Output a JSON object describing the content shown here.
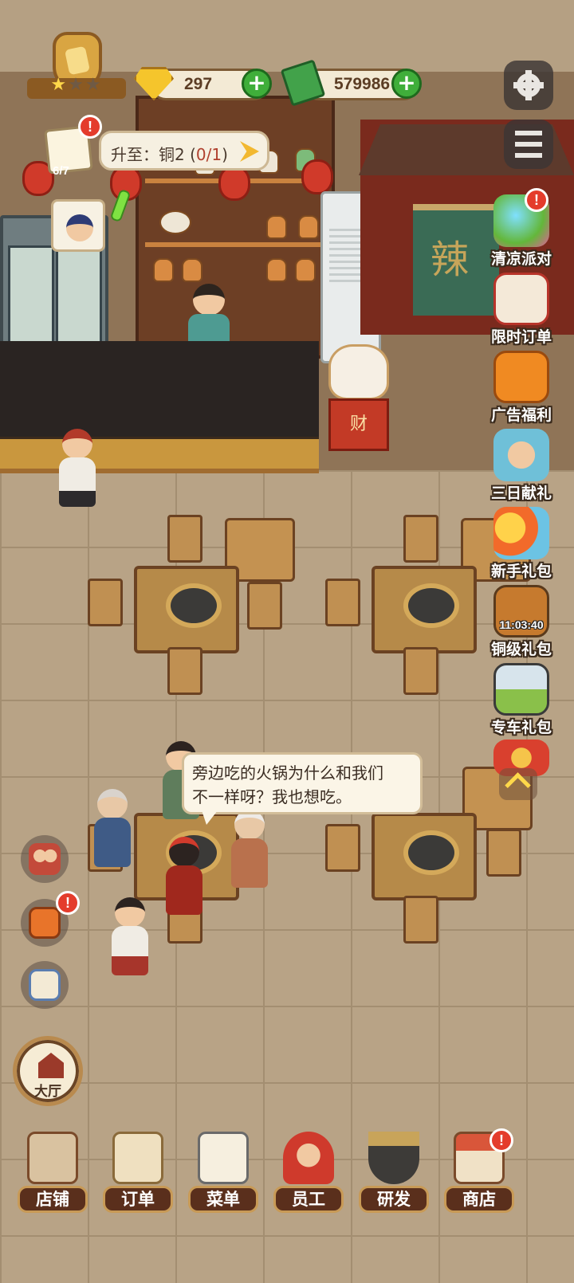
{
  "hud": {
    "badge_stars_on": 1,
    "badge_stars_total": 3,
    "gems": "297",
    "cash": "579986"
  },
  "upgrade": {
    "label": "升至：铜2 (",
    "progress": "0/1",
    "suffix": ")"
  },
  "tasks": {
    "count": "6/7"
  },
  "events": [
    {
      "label": "清凉派对"
    },
    {
      "label": "限时订单"
    },
    {
      "label": "广告福利"
    },
    {
      "label": "三日献礼"
    },
    {
      "label": "新手礼包"
    },
    {
      "label": "铜级礼包",
      "timer": "11:03:40"
    },
    {
      "label": "专车礼包"
    }
  ],
  "speech": {
    "line1": "旁边吃的火锅为什么和我们",
    "line2": "不一样呀？我也想吃。"
  },
  "scene": {
    "curtain_char": "辣",
    "box_char": "财"
  },
  "hall": {
    "label": "大厅"
  },
  "nav": [
    {
      "label": "店铺"
    },
    {
      "label": "订单"
    },
    {
      "label": "菜单"
    },
    {
      "label": "员工"
    },
    {
      "label": "研发"
    },
    {
      "label": "商店"
    }
  ],
  "colors": {
    "accent_green": "#3fae3a",
    "alert_red": "#e43c2c",
    "gold": "#d9a542"
  }
}
